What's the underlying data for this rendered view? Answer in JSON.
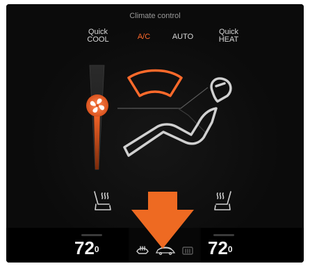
{
  "header": {
    "title": "Climate control"
  },
  "modes": {
    "quick_cool": [
      "Quick",
      "COOL"
    ],
    "ac": "A/C",
    "auto": "AUTO",
    "quick_heat": [
      "Quick",
      "HEAT"
    ]
  },
  "fan": {
    "icon": "fan-icon",
    "level": 0.55
  },
  "airflow": {
    "icons": [
      "windshield-vent-icon",
      "seated-person-airflow-icon"
    ]
  },
  "seat_heaters": {
    "left_icon": "seat-heat-icon",
    "right_icon": "seat-heat-icon"
  },
  "temperatures": {
    "left": {
      "value": "72",
      "decimal": "0"
    },
    "right": {
      "value": "72",
      "decimal": "0"
    }
  },
  "bottom_icons": [
    "front-defrost-icon",
    "car-recirculation-icon",
    "rear-defrost-icon"
  ],
  "overlay": {
    "icon": "down-arrow-icon",
    "color": "#ee6a22"
  },
  "colors": {
    "accent": "#ff6a2b",
    "background": "#0b0b0b",
    "text": "#d9d9d9"
  }
}
